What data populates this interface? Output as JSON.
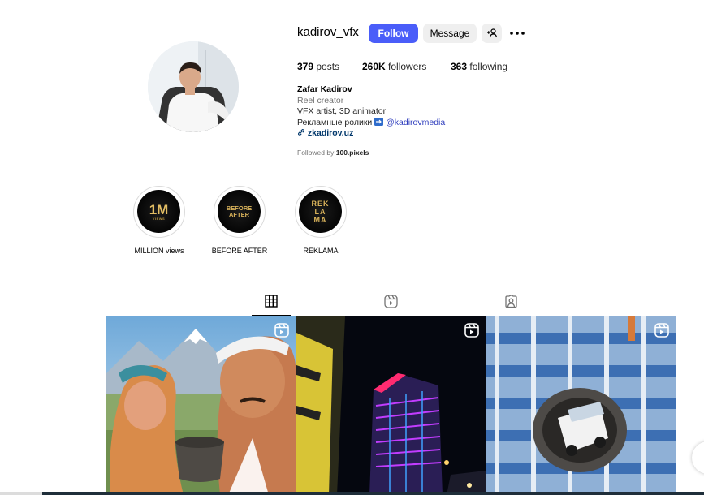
{
  "profile": {
    "username": "kadirov_vfx",
    "follow_label": "Follow",
    "message_label": "Message",
    "stats": {
      "posts_count": "379",
      "posts_label": "posts",
      "followers_count": "260K",
      "followers_label": "followers",
      "following_count": "363",
      "following_label": "following"
    },
    "bio": {
      "name": "Zafar Kadirov",
      "category": "Reel creator",
      "line1": "VFX artist, 3D animator",
      "line2_text": "Рекламные ролики",
      "line2_handle": "@kadirovmedia",
      "website": "zkadirov.uz"
    },
    "followed_by_prefix": "Followed by",
    "followed_by_user": "100.pixels"
  },
  "highlights": [
    {
      "label": "MILLION views",
      "cover_big": "1M",
      "cover_small": "VIEWS"
    },
    {
      "label": "BEFORE AFTER",
      "cover_line1": "BEFORE",
      "cover_line2": "AFTER"
    },
    {
      "label": "REKLAMA",
      "cover_line1": "REK",
      "cover_line2": "LA",
      "cover_line3": "MA"
    }
  ],
  "tabs": [
    {
      "name": "posts",
      "icon": "grid-icon",
      "active": true
    },
    {
      "name": "reels",
      "icon": "reels-icon",
      "active": false
    },
    {
      "name": "tagged",
      "icon": "tagged-icon",
      "active": false
    }
  ],
  "posts": [
    {
      "icon": "reel-icon",
      "subject": "animated couple with clay pot"
    },
    {
      "icon": "reel-icon",
      "subject": "illuminated skyscraper at night"
    },
    {
      "icon": "reel-icon",
      "subject": "van bursting out of building"
    }
  ],
  "colors": {
    "follow_button": "#4a5df9",
    "secondary_button": "#efefef",
    "link": "#2e3dbd"
  }
}
